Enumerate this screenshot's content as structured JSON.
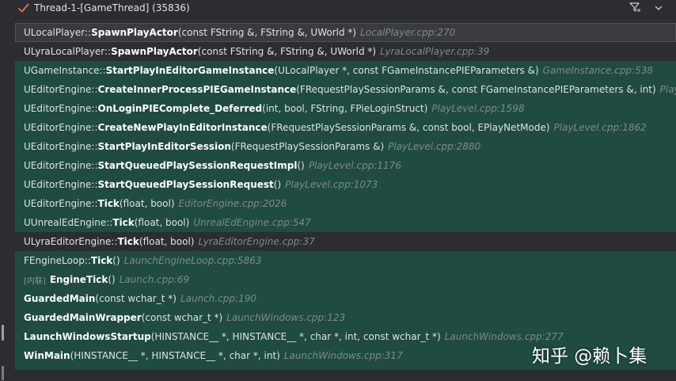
{
  "header": {
    "thread_title": "Thread-1-[GameThread] (35836)"
  },
  "frames": [
    {
      "cls": "ULocalPlayer::",
      "fn": "SpawnPlayActor",
      "args": "(const FString &, FString &, UWorld *)",
      "loc": "LocalPlayer.cpp:270",
      "tag": ""
    },
    {
      "cls": "ULyraLocalPlayer::",
      "fn": "SpawnPlayActor",
      "args": "(const FString &, FString &, UWorld *)",
      "loc": "LyraLocalPlayer.cpp:39",
      "tag": ""
    },
    {
      "cls": "UGameInstance::",
      "fn": "StartPlayInEditorGameInstance",
      "args": "(ULocalPlayer *, const FGameInstancePIEParameters &)",
      "loc": "GameInstance.cpp:538",
      "tag": ""
    },
    {
      "cls": "UEditorEngine::",
      "fn": "CreateInnerProcessPIEGameInstance",
      "args": "(FRequestPlaySessionParams &, const FGameInstancePIEParameters &, int)",
      "loc": "PlayLevel.cpp:",
      "tag": ""
    },
    {
      "cls": "UEditorEngine::",
      "fn": "OnLoginPIEComplete_Deferred",
      "args": "(int, bool, FString, FPieLoginStruct)",
      "loc": "PlayLevel.cpp:1598",
      "tag": ""
    },
    {
      "cls": "UEditorEngine::",
      "fn": "CreateNewPlayInEditorInstance",
      "args": "(FRequestPlaySessionParams &, const bool, EPlayNetMode)",
      "loc": "PlayLevel.cpp:1862",
      "tag": ""
    },
    {
      "cls": "UEditorEngine::",
      "fn": "StartPlayInEditorSession",
      "args": "(FRequestPlaySessionParams &)",
      "loc": "PlayLevel.cpp:2880",
      "tag": ""
    },
    {
      "cls": "UEditorEngine::",
      "fn": "StartQueuedPlaySessionRequestImpl",
      "args": "()",
      "loc": "PlayLevel.cpp:1176",
      "tag": ""
    },
    {
      "cls": "UEditorEngine::",
      "fn": "StartQueuedPlaySessionRequest",
      "args": "()",
      "loc": "PlayLevel.cpp:1073",
      "tag": ""
    },
    {
      "cls": "UEditorEngine::",
      "fn": "Tick",
      "args": "(float, bool)",
      "loc": "EditorEngine.cpp:2026",
      "tag": ""
    },
    {
      "cls": "UUnrealEdEngine::",
      "fn": "Tick",
      "args": "(float, bool)",
      "loc": "UnrealEdEngine.cpp:547",
      "tag": ""
    },
    {
      "cls": "ULyraEditorEngine::",
      "fn": "Tick",
      "args": "(float, bool)",
      "loc": "LyraEditorEngine.cpp:37",
      "tag": ""
    },
    {
      "cls": "FEngineLoop::",
      "fn": "Tick",
      "args": "()",
      "loc": "LaunchEngineLoop.cpp:5863",
      "tag": ""
    },
    {
      "cls": "",
      "fn": "EngineTick",
      "args": "()",
      "loc": "Launch.cpp:69",
      "tag": "[内联]"
    },
    {
      "cls": "",
      "fn": "GuardedMain",
      "args": "(const wchar_t *)",
      "loc": "Launch.cpp:190",
      "tag": ""
    },
    {
      "cls": "",
      "fn": "GuardedMainWrapper",
      "args": "(const wchar_t *)",
      "loc": "LaunchWindows.cpp:123",
      "tag": ""
    },
    {
      "cls": "",
      "fn": "LaunchWindowsStartup",
      "args": "(HINSTANCE__ *, HINSTANCE__ *, char *, int, const wchar_t *)",
      "loc": "LaunchWindows.cpp:277",
      "tag": ""
    },
    {
      "cls": "",
      "fn": "WinMain",
      "args": "(HINSTANCE__ *, HINSTANCE__ *, char *, int)",
      "loc": "LaunchWindows.cpp:317",
      "tag": ""
    }
  ],
  "watermark": "知乎 @赖卜集",
  "colors": {
    "panel_bg": "#2b2d30",
    "frame_highlight": "#1f4b40",
    "selected_row": "#393b40",
    "location_text": "#7f8a86"
  },
  "icons": {
    "check": "checkmark-icon",
    "filter": "filter-icon",
    "chevron": "chevron-down-icon"
  }
}
